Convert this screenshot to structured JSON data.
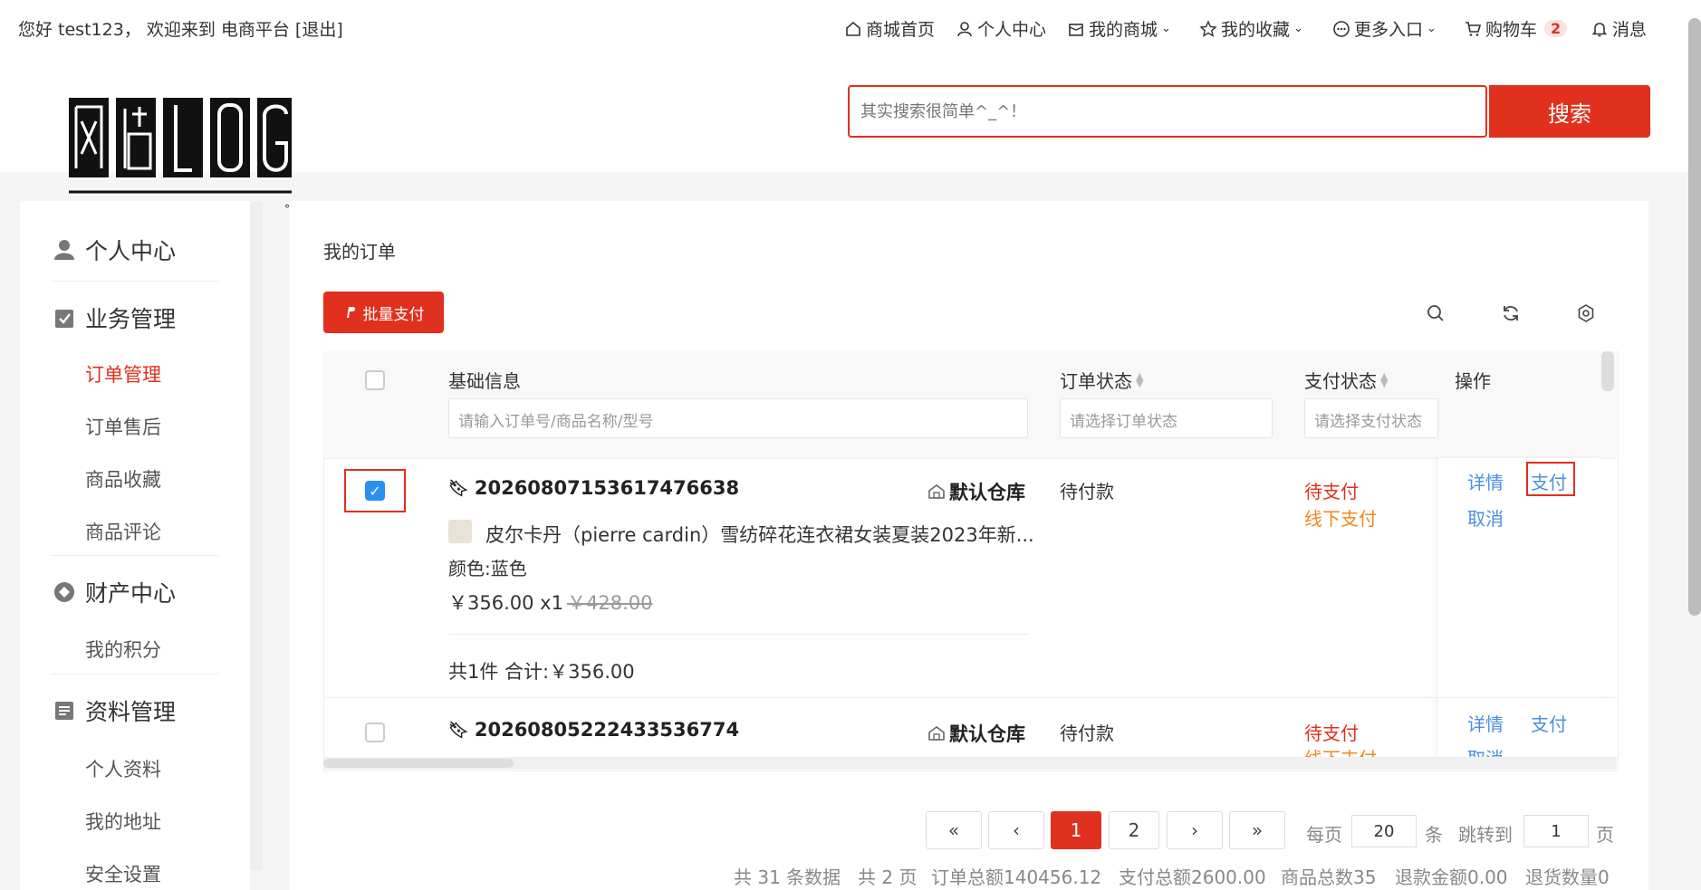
{
  "topbar": {
    "greeting": "您好 test123， 欢迎来到 电商平台 [退出]",
    "nav": {
      "home": "商城首页",
      "personal": "个人中心",
      "my_mall": "我的商城",
      "favorites": "我的收藏",
      "more": "更多入口",
      "cart": "购物车",
      "cart_count": "2",
      "messages": "消息"
    }
  },
  "search": {
    "placeholder": "其实搜索很简单^_^！",
    "button": "搜索"
  },
  "sidebar": {
    "personal_center": "个人中心",
    "business": {
      "title": "业务管理",
      "items": [
        "订单管理",
        "订单售后",
        "商品收藏",
        "商品评论"
      ]
    },
    "assets": {
      "title": "财产中心",
      "items": [
        "我的积分"
      ]
    },
    "profile": {
      "title": "资料管理",
      "items": [
        "个人资料",
        "我的地址",
        "安全设置"
      ]
    }
  },
  "main": {
    "title": "我的订单",
    "batch_pay": "批量支付",
    "columns": {
      "basic": "基础信息",
      "order_status": "订单状态",
      "pay_status": "支付状态",
      "actions": "操作"
    },
    "filters": {
      "basic": "请输入订单号/商品名称/型号",
      "order_status": "请选择订单状态",
      "pay_status": "请选择支付状态"
    },
    "orders": [
      {
        "order_no": "20260807153617476638",
        "warehouse": "默认仓库",
        "product": "皮尔卡丹（pierre cardin）雪纺碎花连衣裙女装夏装2023年新...",
        "spec": "颜色:蓝色",
        "price": "￥356.00 x1",
        "orig_price": "￥428.00",
        "total": "共1件 合计:￥356.00",
        "order_status": "待付款",
        "pay_status": "待支付",
        "pay_method": "线下支付",
        "actions": [
          "详情",
          "支付",
          "取消"
        ]
      },
      {
        "order_no": "20260805222433536774",
        "warehouse": "默认仓库",
        "order_status": "待付款",
        "pay_status": "待支付",
        "pay_method": "线下支付",
        "actions": [
          "详情",
          "支付",
          "取消"
        ]
      }
    ]
  },
  "pagination": {
    "pages": [
      "1",
      "2"
    ],
    "current": "1",
    "per_page_label": "每页",
    "per_page": "20",
    "unit": "条",
    "jump_label": "跳转到",
    "jump_value": "1",
    "page_unit": "页",
    "summary": {
      "records": "共 31 条数据",
      "pages": "共 2 页",
      "order_total": "订单总额140456.12",
      "pay_total": "支付总额2600.00",
      "goods_count": "商品总数35",
      "refund_amount": "退款金额0.00",
      "return_count": "退货数量0"
    }
  },
  "colors": {
    "accent": "#e0301e",
    "link": "#4a90e2",
    "checkbox": "#2b8ff2",
    "warning": "#f08a1c"
  }
}
